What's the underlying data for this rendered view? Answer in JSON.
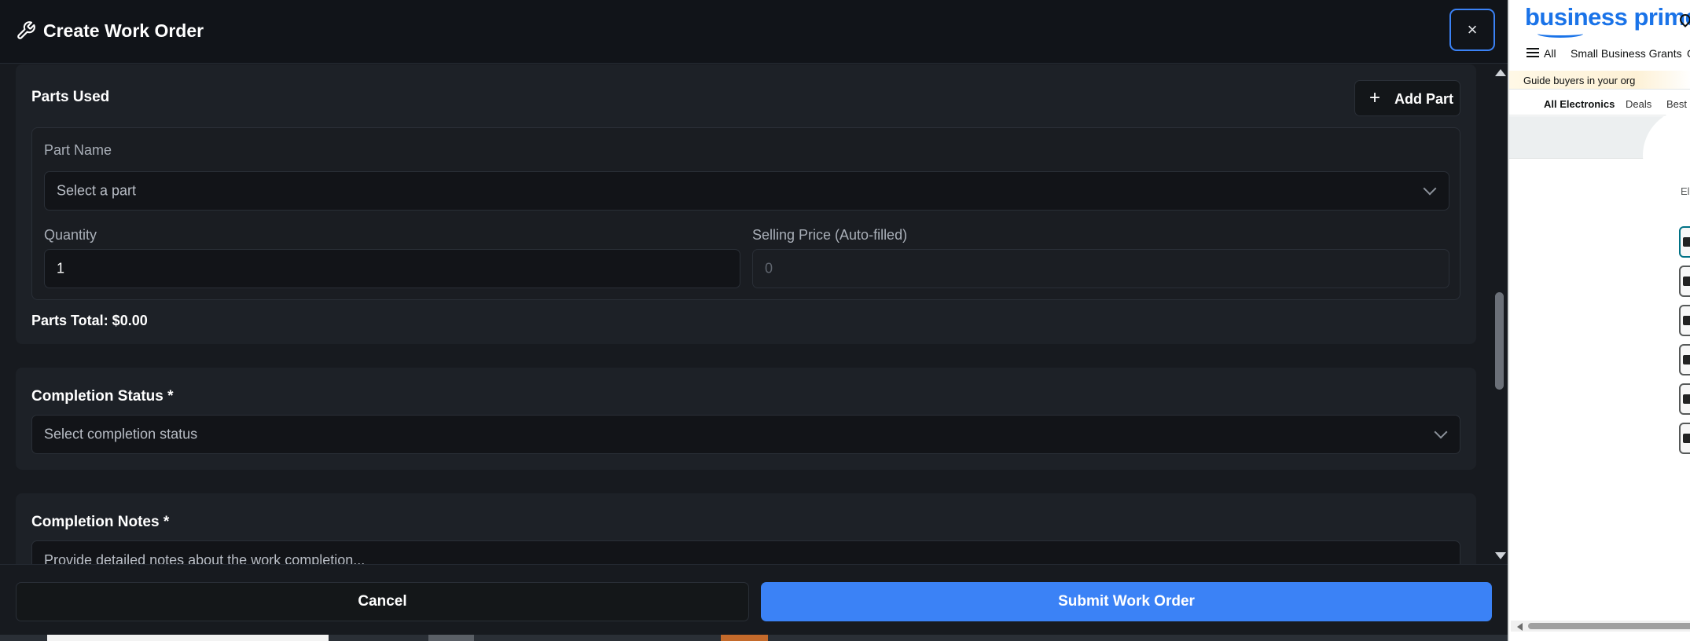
{
  "modal": {
    "title": "Create Work Order",
    "close_label": "×",
    "parts": {
      "title": "Parts Used",
      "add_part_label": "Add Part",
      "part_name_label": "Part Name",
      "part_name_placeholder": "Select a part",
      "quantity_label": "Quantity",
      "quantity_value": "1",
      "selling_price_label": "Selling Price (Auto-filled)",
      "selling_price_value": "0",
      "parts_total": "Parts Total: $0.00"
    },
    "completion_status": {
      "label": "Completion Status *",
      "placeholder": "Select completion status"
    },
    "completion_notes": {
      "label": "Completion Notes *",
      "placeholder": "Provide detailed notes about the work completion..."
    },
    "footer": {
      "cancel_label": "Cancel",
      "submit_label": "Submit Work Order"
    }
  },
  "amazon": {
    "logo": "business prime",
    "nav": {
      "all": "All",
      "grants": "Small Business Grants",
      "more": "G"
    },
    "guide_text": "Guide buyers in your org",
    "sub_nav": {
      "all_electronics": "All Electronics",
      "deals": "Deals",
      "best": "Best S"
    },
    "category_fragment": "Ele"
  },
  "colors": {
    "accent": "#3b82f6",
    "background": "#171a1f",
    "header": "#111419",
    "amazon_blue": "#1a73e8"
  }
}
